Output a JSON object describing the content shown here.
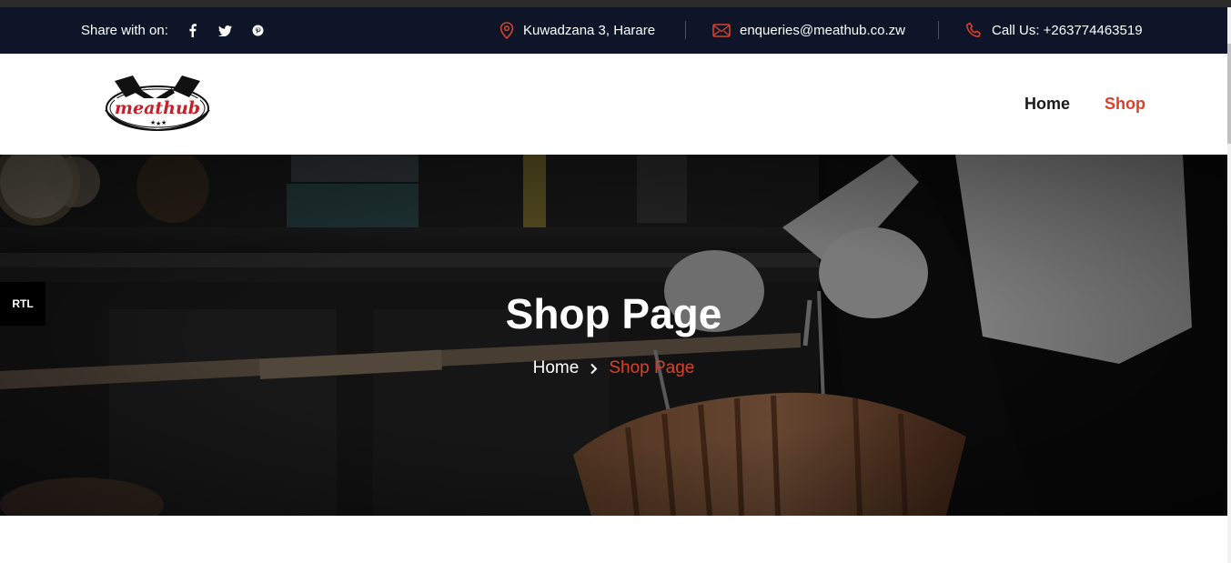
{
  "topbar": {
    "share_label": "Share with on:",
    "social_icons": [
      "facebook-icon",
      "twitter-icon",
      "pinterest-icon"
    ],
    "address": "Kuwadzana 3, Harare",
    "email": "enqueries@meathub.co.zw",
    "phone": "Call Us: +263774463519"
  },
  "logo": {
    "text": "meathub"
  },
  "nav": {
    "home": "Home",
    "shop": "Shop"
  },
  "hero": {
    "title": "Shop Page",
    "breadcrumb_home": "Home",
    "breadcrumb_current": "Shop Page"
  },
  "rtl_button": "RTL",
  "colors": {
    "topbar_bg": "#0e1529",
    "accent": "#d9412a",
    "text_dark": "#1a1a1a"
  }
}
